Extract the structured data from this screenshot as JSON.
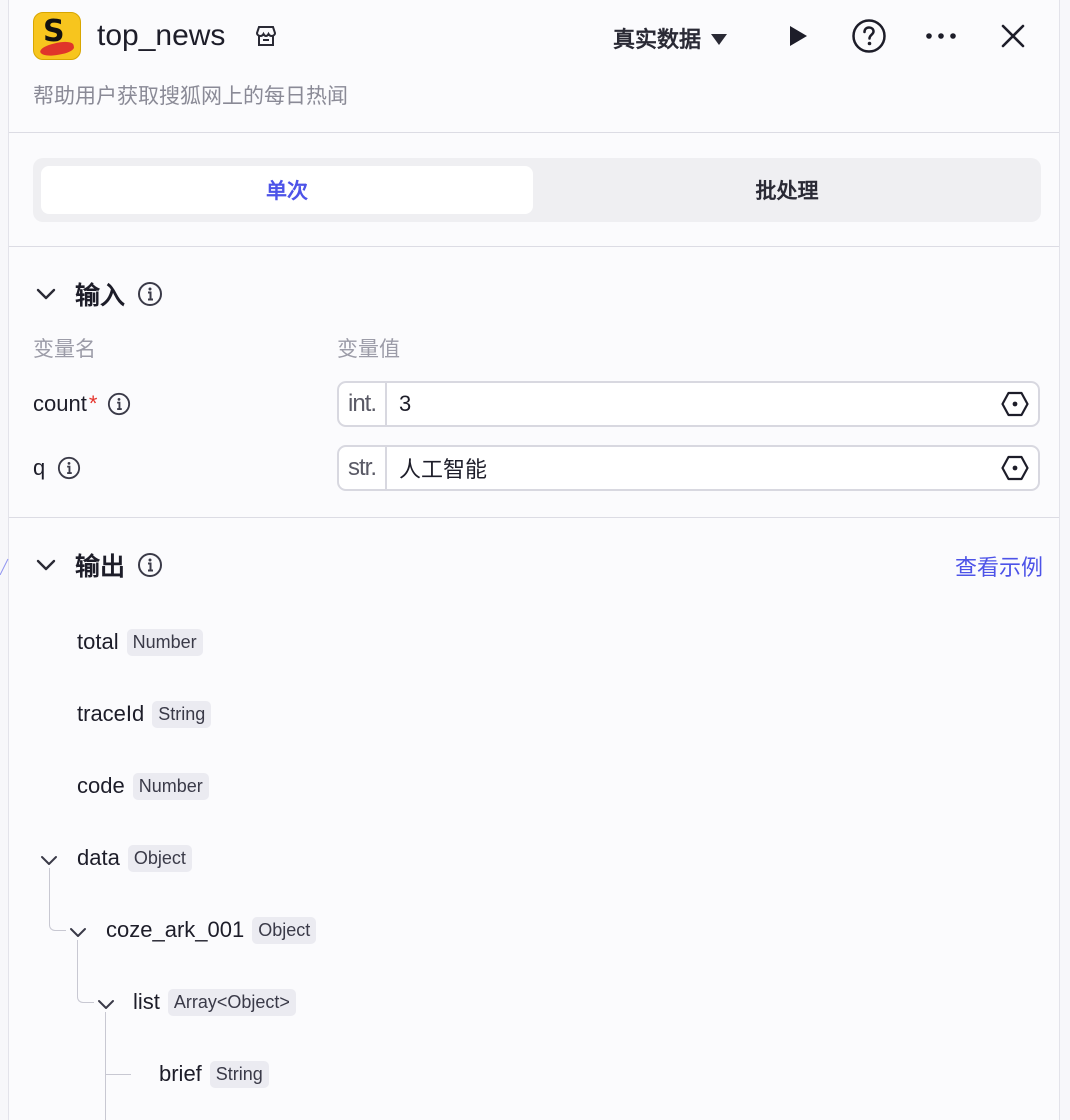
{
  "header": {
    "title": "top_news",
    "description": "帮助用户获取搜狐网上的每日热闻",
    "mode_label": "真实数据"
  },
  "tabs": [
    {
      "label": "单次",
      "active": true
    },
    {
      "label": "批处理",
      "active": false
    }
  ],
  "input": {
    "title": "输入",
    "col_name": "变量名",
    "col_value": "变量值",
    "fields": [
      {
        "name": "count",
        "required": "*",
        "type": "int.",
        "value": "3"
      },
      {
        "name": "q",
        "required": "",
        "type": "str.",
        "value": "人工智能"
      }
    ]
  },
  "output": {
    "title": "输出",
    "see_example": "查看示例",
    "items": [
      {
        "name": "total",
        "type": "Number"
      },
      {
        "name": "traceId",
        "type": "String"
      },
      {
        "name": "code",
        "type": "Number"
      },
      {
        "name": "data",
        "type": "Object"
      },
      {
        "name": "coze_ark_001",
        "type": "Object"
      },
      {
        "name": "list",
        "type": "Array<Object>"
      },
      {
        "name": "brief",
        "type": "String"
      }
    ]
  },
  "colors": {
    "accent": "#4d53e8",
    "required": "#e5342c",
    "logo": "#f7c51e"
  },
  "icons": [
    "plugin-logo-icon",
    "store-icon",
    "caret-down-icon",
    "play-icon",
    "help-icon",
    "more-icon",
    "close-icon",
    "chevron-down-icon",
    "info-icon",
    "variable-hex-icon"
  ]
}
